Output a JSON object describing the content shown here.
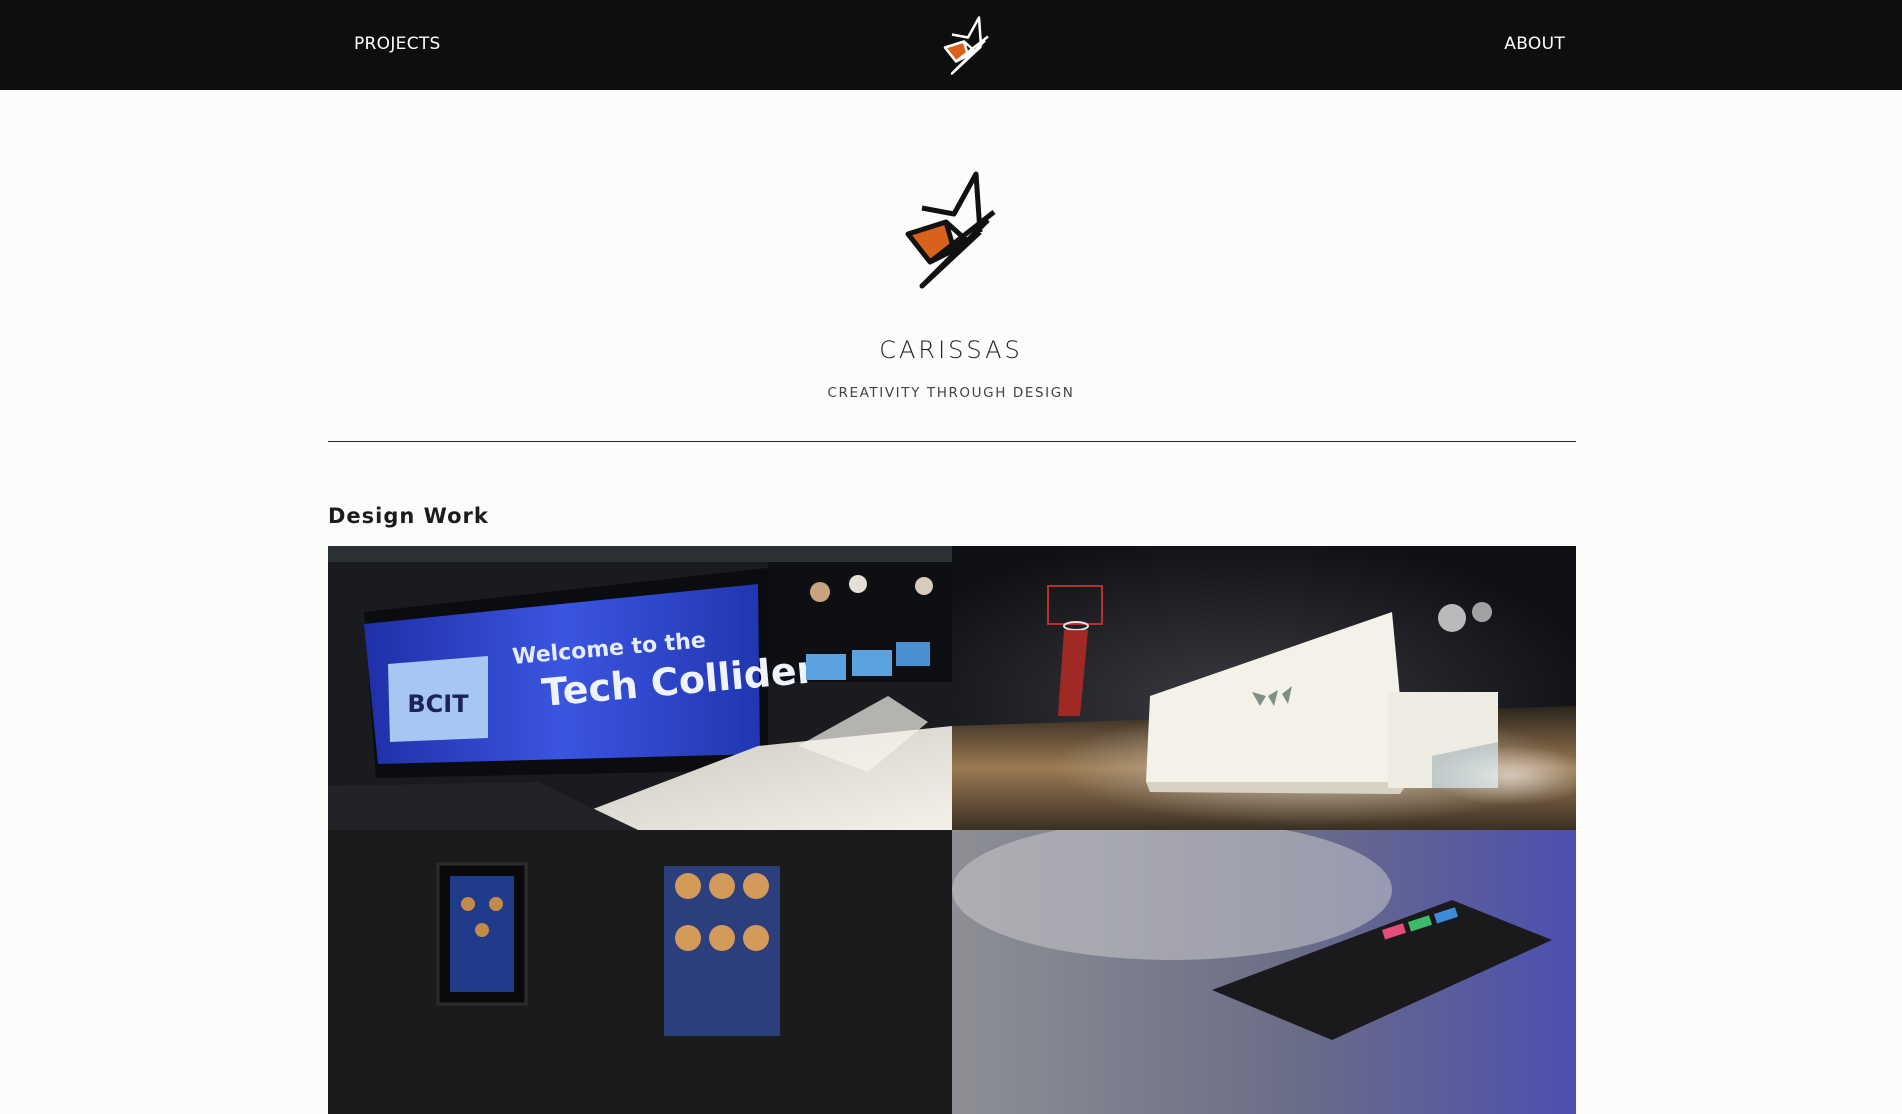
{
  "nav": {
    "projects_label": "PROJECTS",
    "about_label": "ABOUT",
    "logo_icon": "carissas-logo-icon"
  },
  "hero": {
    "logo_icon": "carissas-logo-icon",
    "title": "CARISSAS",
    "tagline": "CREATIVITY THROUGH DESIGN"
  },
  "section": {
    "title": "Design Work"
  },
  "tiles": [
    {
      "screen_text_line1": "Welcome to the",
      "screen_text_line2": "Tech Collider",
      "logo_text": "BCIT"
    },
    {},
    {},
    {}
  ],
  "colors": {
    "topbar": "#0e0e0e",
    "background": "#fcfcfb",
    "logo_accent": "#d9621a"
  }
}
